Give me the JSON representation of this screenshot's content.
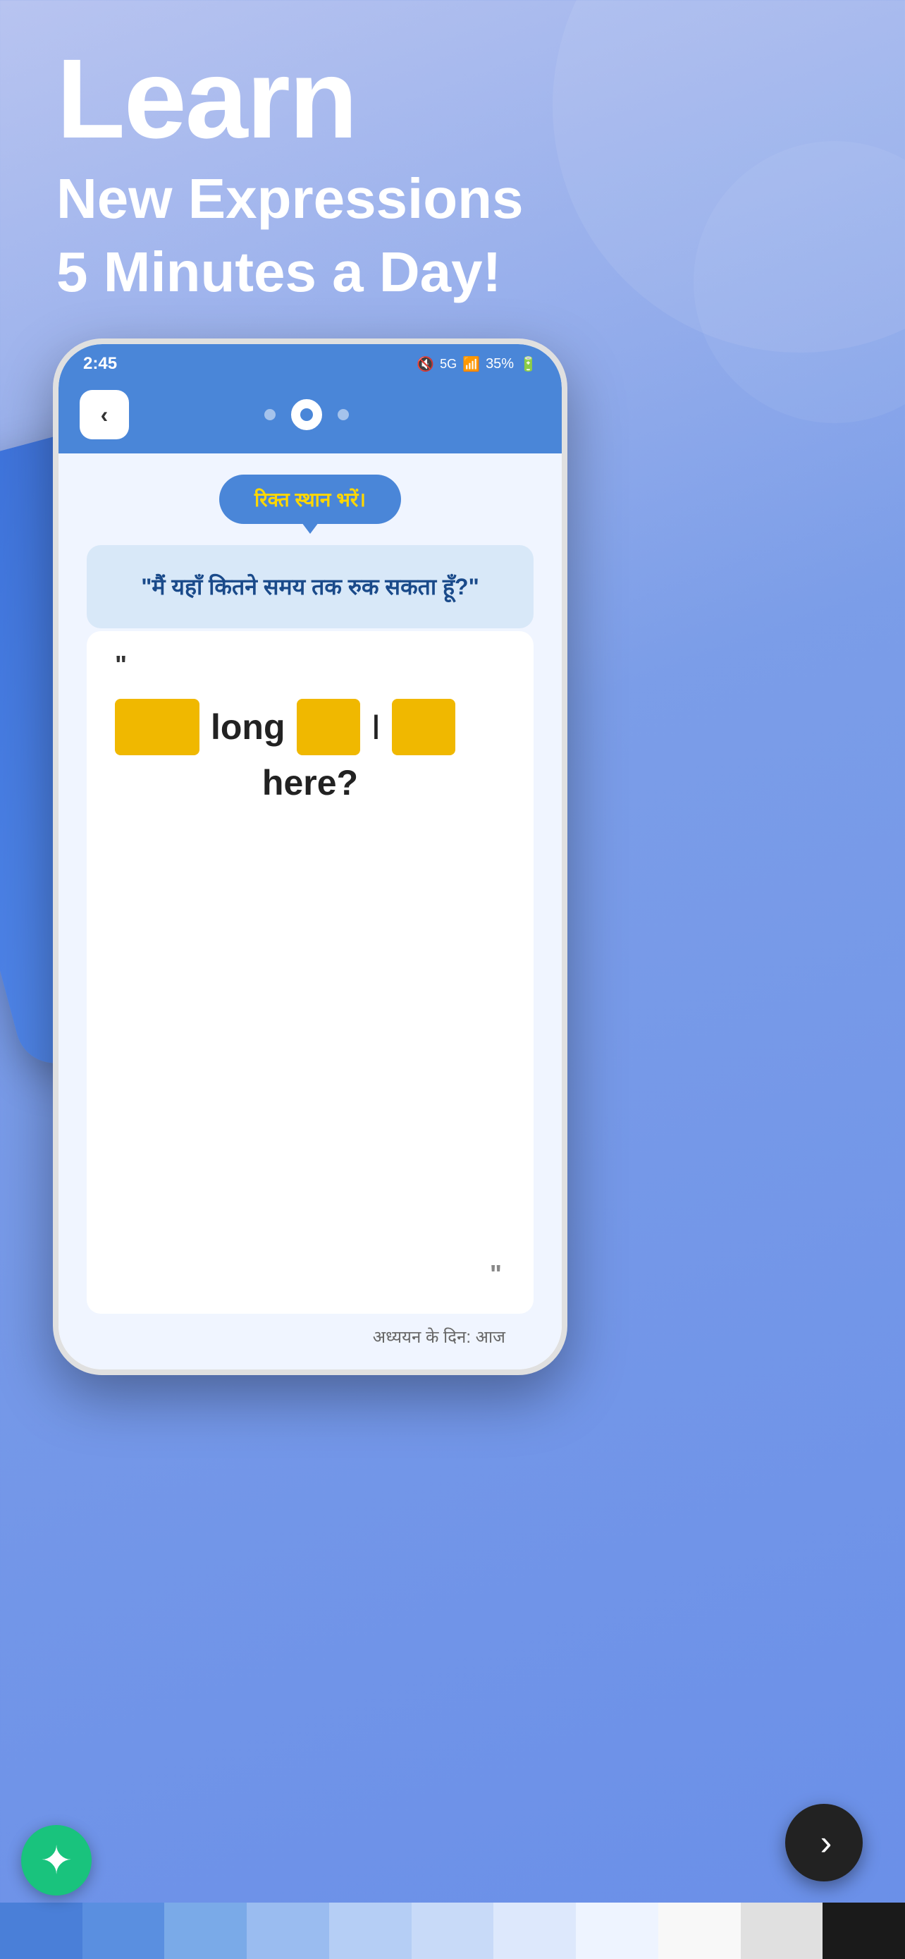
{
  "hero": {
    "learn_label": "Learn",
    "subtitle_line1": "New Expressions",
    "subtitle_line2": "5 Minutes a Day!"
  },
  "phone": {
    "status_bar": {
      "time": "2:45",
      "battery": "35%",
      "network": "5G"
    },
    "app_bar": {
      "back_label": "‹"
    },
    "fill_bubble": {
      "label": "रिक्त स्थान भरें।"
    },
    "sentence_card": {
      "hindi_text": "\"मैं यहाँ कितने समय तक रुक सकता हूँ?\""
    },
    "answer_card": {
      "quote_open": "\"",
      "blank1": "",
      "word_long": "long",
      "blank2": "",
      "separator": "I",
      "blank3": "",
      "word_here": "here?",
      "quote_close": "\"",
      "study_label": "अध्ययन के दिन: आज"
    }
  },
  "next_button": {
    "label": "›"
  },
  "bottom_strips": {
    "colors": [
      "#4a7fd8",
      "#6a9fe0",
      "#8ab5e8",
      "#aacbf0",
      "#c0d8f8",
      "#ddeeff",
      "#f0f5ff",
      "#ffffff",
      "#e8e8e8",
      "#d0d0d0",
      "#1a1a1a"
    ]
  }
}
